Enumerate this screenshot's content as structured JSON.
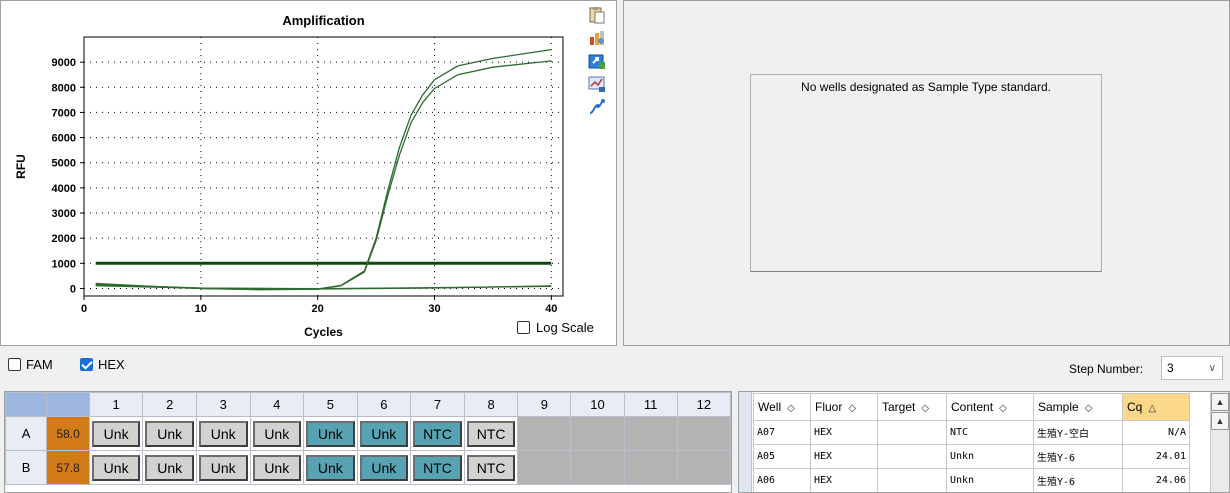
{
  "chart": {
    "tools": [
      "clipboard-icon",
      "chart-settings-icon",
      "export-icon",
      "plot-image-icon",
      "curve-fit-icon"
    ],
    "log_scale_label": "Log Scale"
  },
  "chart_data": {
    "type": "line",
    "title": "Amplification",
    "xlabel": "Cycles",
    "ylabel": "RFU",
    "xlim": [
      0,
      41
    ],
    "ylim": [
      -300,
      10000
    ],
    "xticks": [
      0,
      10,
      20,
      30,
      40
    ],
    "yticks": [
      0,
      1000,
      2000,
      3000,
      4000,
      5000,
      6000,
      7000,
      8000,
      9000
    ],
    "grid": "dotted",
    "threshold": 1000,
    "series": [
      {
        "x": [
          1,
          5,
          10,
          15,
          20,
          22,
          24,
          25,
          26,
          27,
          28,
          29,
          30,
          32,
          35,
          40
        ],
        "values": [
          200,
          100,
          0,
          -50,
          -30,
          120,
          700,
          2000,
          3900,
          5600,
          6900,
          7700,
          8300,
          8850,
          9150,
          9500
        ]
      },
      {
        "x": [
          1,
          5,
          10,
          15,
          20,
          22,
          24,
          25,
          26,
          27,
          28,
          29,
          30,
          32,
          35,
          40
        ],
        "values": [
          180,
          90,
          0,
          -40,
          -20,
          110,
          650,
          1900,
          3700,
          5300,
          6600,
          7400,
          7950,
          8500,
          8800,
          9050
        ]
      },
      {
        "x": [
          1,
          10,
          20,
          30,
          40
        ],
        "values": [
          150,
          20,
          -20,
          20,
          100
        ]
      },
      {
        "x": [
          1,
          10,
          20,
          30,
          40
        ],
        "values": [
          110,
          10,
          -10,
          30,
          80
        ]
      }
    ]
  },
  "standard_curve": {
    "message": "No wells designated as Sample Type standard."
  },
  "fluors": [
    {
      "label": "FAM",
      "checked": false
    },
    {
      "label": "HEX",
      "checked": true
    }
  ],
  "step": {
    "label": "Step Number:",
    "value": "3"
  },
  "plate": {
    "columns": [
      "1",
      "2",
      "3",
      "4",
      "5",
      "6",
      "7",
      "8",
      "9",
      "10",
      "11",
      "12"
    ],
    "rows": [
      {
        "label": "A",
        "temp": "58.0",
        "wells": [
          {
            "text": "Unk",
            "selected": false
          },
          {
            "text": "Unk",
            "selected": false
          },
          {
            "text": "Unk",
            "selected": false
          },
          {
            "text": "Unk",
            "selected": false
          },
          {
            "text": "Unk",
            "selected": true
          },
          {
            "text": "Unk",
            "selected": true
          },
          {
            "text": "NTC",
            "selected": true
          },
          {
            "text": "NTC",
            "selected": false
          },
          null,
          null,
          null,
          null
        ]
      },
      {
        "label": "B",
        "temp": "57.8",
        "wells": [
          {
            "text": "Unk",
            "selected": false
          },
          {
            "text": "Unk",
            "selected": false
          },
          {
            "text": "Unk",
            "selected": false
          },
          {
            "text": "Unk",
            "selected": false
          },
          {
            "text": "Unk",
            "selected": true
          },
          {
            "text": "Unk",
            "selected": true
          },
          {
            "text": "NTC",
            "selected": true
          },
          {
            "text": "NTC",
            "selected": false
          },
          null,
          null,
          null,
          null
        ]
      }
    ]
  },
  "results": {
    "columns": [
      {
        "label": "Well",
        "sort": "◇"
      },
      {
        "label": "Fluor",
        "sort": "◇"
      },
      {
        "label": "Target",
        "sort": "◇"
      },
      {
        "label": "Content",
        "sort": "◇"
      },
      {
        "label": "Sample",
        "sort": "◇"
      },
      {
        "label": "Cq",
        "sort": "△"
      }
    ],
    "rows": [
      [
        "A07",
        "HEX",
        "",
        "NTC",
        "生殖Y-空白",
        "N/A"
      ],
      [
        "A05",
        "HEX",
        "",
        "Unkn",
        "生殖Y-6",
        "24.01"
      ],
      [
        "A06",
        "HEX",
        "",
        "Unkn",
        "生殖Y-6",
        "24.06"
      ]
    ]
  }
}
